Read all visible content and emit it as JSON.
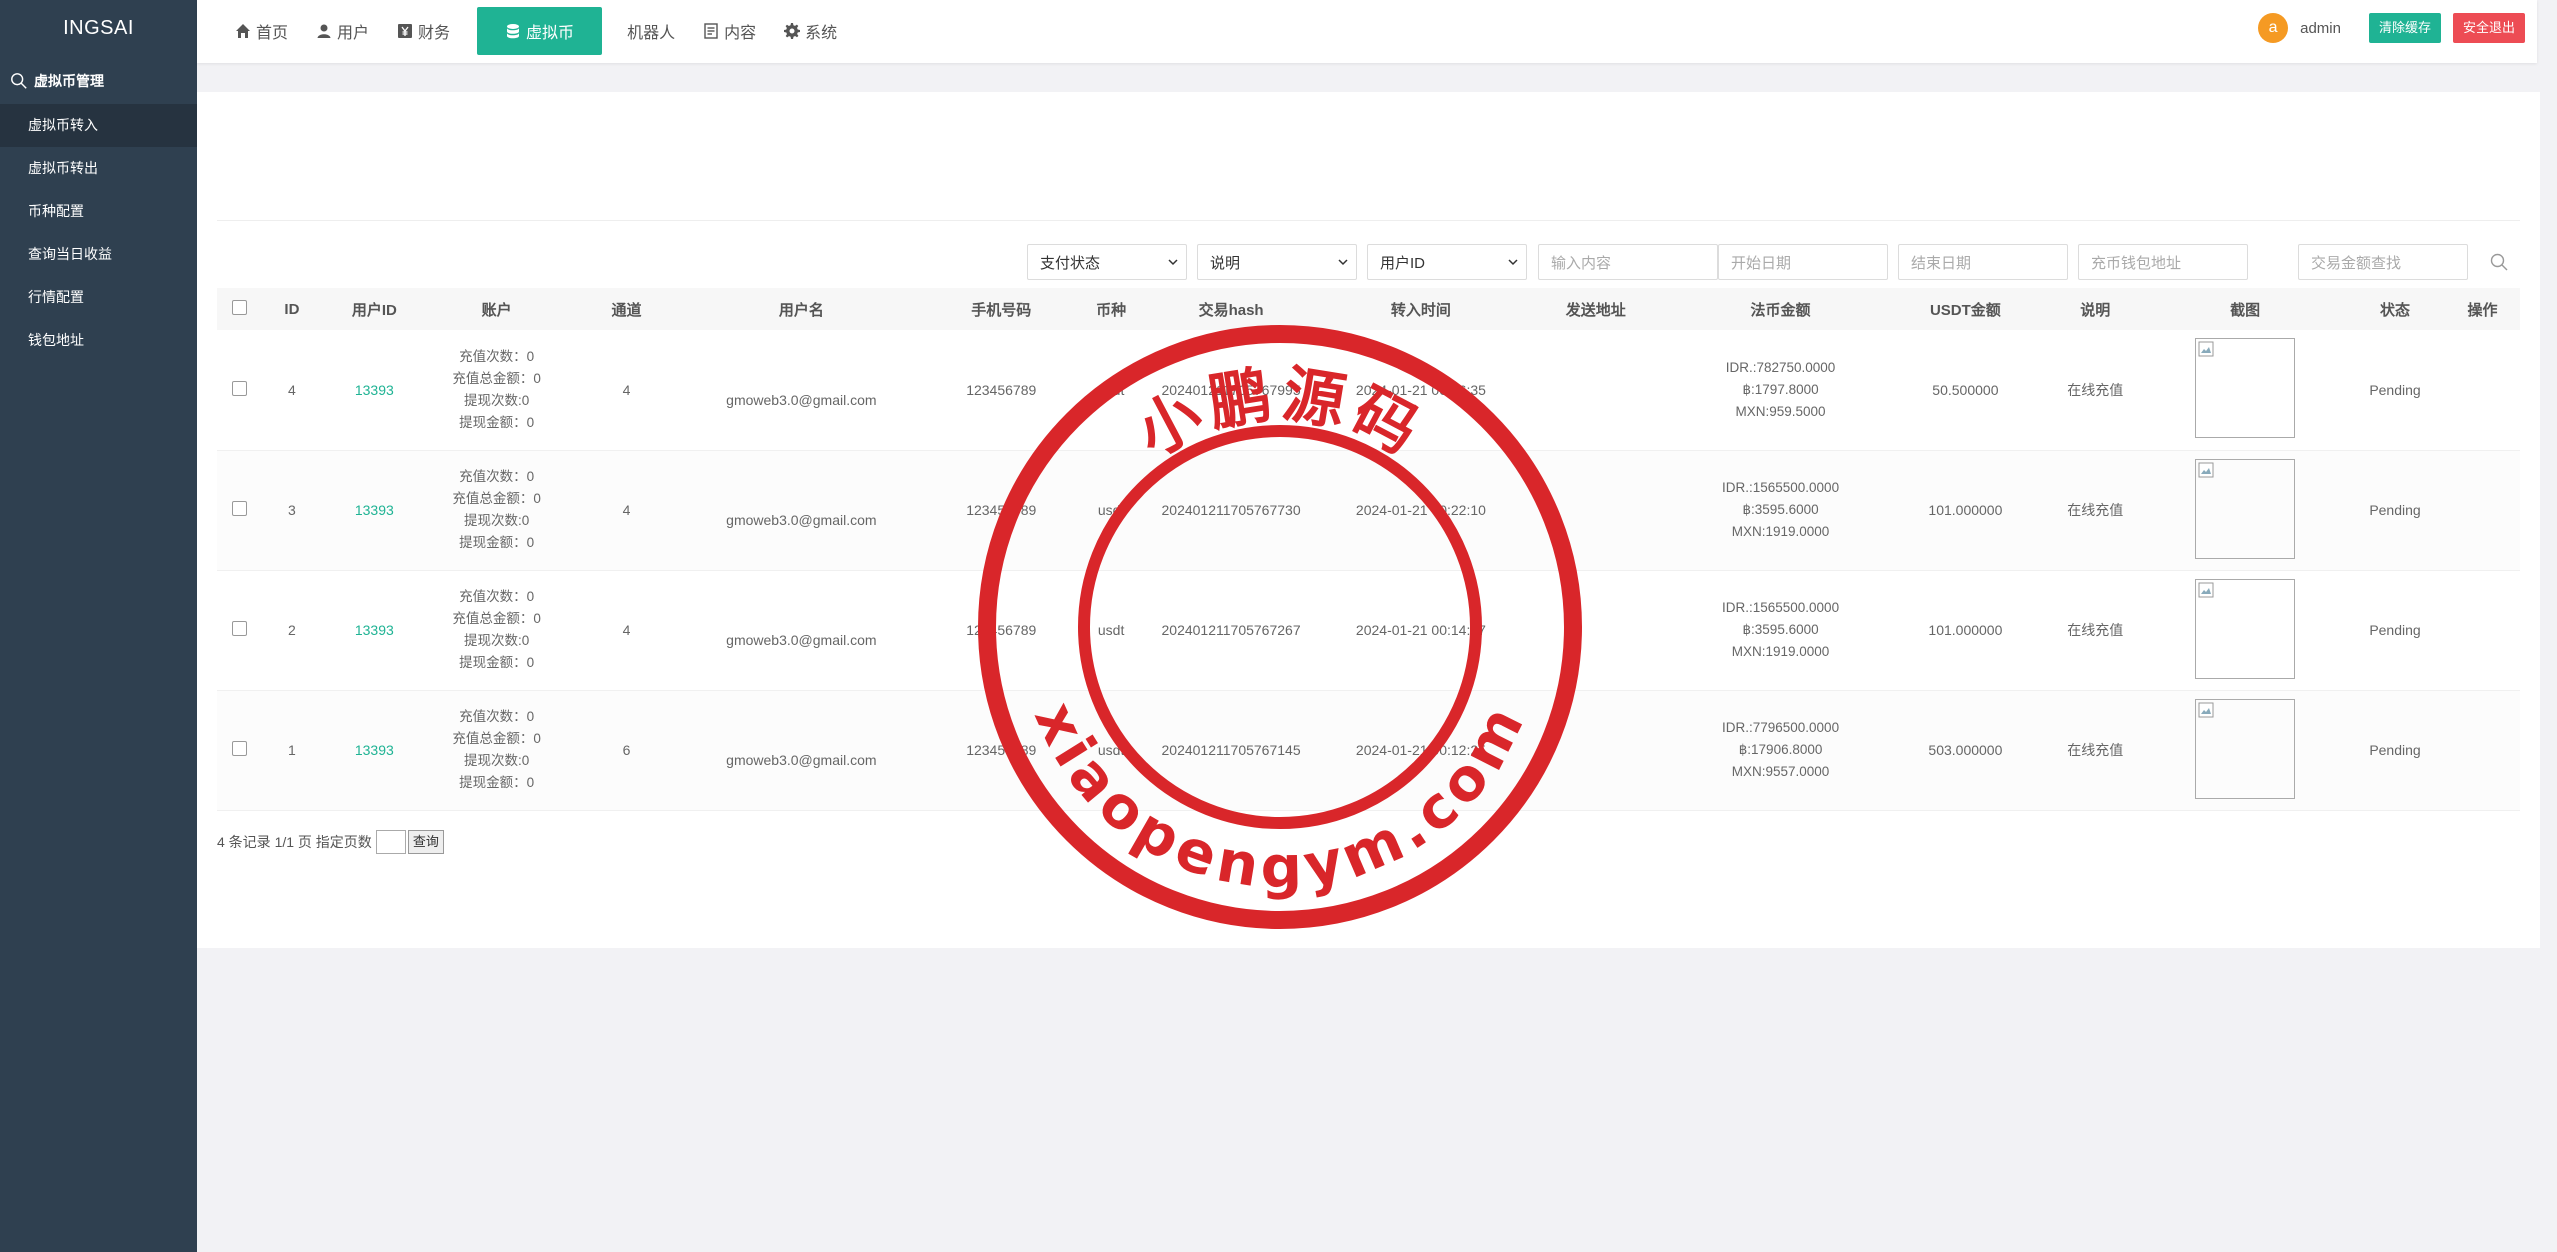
{
  "app": {
    "logo": "INGSAI"
  },
  "sidebar": {
    "section_title": "虚拟币管理",
    "items": [
      {
        "label": "虚拟币转入",
        "active": true
      },
      {
        "label": "虚拟币转出"
      },
      {
        "label": "币种配置"
      },
      {
        "label": "查询当日收益"
      },
      {
        "label": "行情配置"
      },
      {
        "label": "钱包地址"
      }
    ]
  },
  "topnav": {
    "items": [
      {
        "label": "首页",
        "icon": "home-icon"
      },
      {
        "label": "用户",
        "icon": "user-icon"
      },
      {
        "label": "财务",
        "icon": "yen-icon"
      },
      {
        "label": "虚拟币",
        "icon": "database-icon",
        "active": true
      },
      {
        "label": "机器人"
      },
      {
        "label": "内容",
        "icon": "document-icon"
      },
      {
        "label": "系统",
        "icon": "gear-icon"
      }
    ],
    "avatar_letter": "a",
    "username": "admin",
    "clear_cache": "清除缓存",
    "logout": "安全退出"
  },
  "filters": {
    "pay_status": "支付状态",
    "description": "说明",
    "user_id": "用户ID",
    "input_placeholder": "输入内容",
    "start_date_placeholder": "开始日期",
    "end_date_placeholder": "结束日期",
    "wallet_placeholder": "充币钱包地址",
    "amount_placeholder": "交易金额查找"
  },
  "table": {
    "columns": [
      "ID",
      "用户ID",
      "账户",
      "通道",
      "用户名",
      "手机号码",
      "币种",
      "交易hash",
      "转入时间",
      "发送地址",
      "法币金额",
      "USDT金额",
      "说明",
      "截图",
      "状态",
      "操作"
    ],
    "rows": [
      {
        "id": "4",
        "user_id": "13393",
        "account": [
          "充值次数：0",
          "充值总金额：0",
          "提现次数:0",
          "提现金额：0"
        ],
        "channel": "4",
        "username": "gmoweb3.0@gmail.com",
        "phone": "123456789",
        "coin": "usdt",
        "hash": "202401211705767995",
        "time": "2024-01-21 00:26:35",
        "sender": "",
        "fiat": [
          "IDR.:782750.0000",
          "฿:1797.8000",
          "MXN:959.5000"
        ],
        "usdt": "50.500000",
        "note": "在线充值",
        "status": "Pending"
      },
      {
        "id": "3",
        "user_id": "13393",
        "account": [
          "充值次数：0",
          "充值总金额：0",
          "提现次数:0",
          "提现金额：0"
        ],
        "channel": "4",
        "username": "gmoweb3.0@gmail.com",
        "phone": "123456789",
        "coin": "usdt",
        "hash": "202401211705767730",
        "time": "2024-01-21 00:22:10",
        "sender": "",
        "fiat": [
          "IDR.:1565500.0000",
          "฿:3595.6000",
          "MXN:1919.0000"
        ],
        "usdt": "101.000000",
        "note": "在线充值",
        "status": "Pending"
      },
      {
        "id": "2",
        "user_id": "13393",
        "account": [
          "充值次数：0",
          "充值总金额：0",
          "提现次数:0",
          "提现金额：0"
        ],
        "channel": "4",
        "username": "gmoweb3.0@gmail.com",
        "phone": "123456789",
        "coin": "usdt",
        "hash": "202401211705767267",
        "time": "2024-01-21 00:14:27",
        "sender": "",
        "fiat": [
          "IDR.:1565500.0000",
          "฿:3595.6000",
          "MXN:1919.0000"
        ],
        "usdt": "101.000000",
        "note": "在线充值",
        "status": "Pending"
      },
      {
        "id": "1",
        "user_id": "13393",
        "account": [
          "充值次数：0",
          "充值总金额：0",
          "提现次数:0",
          "提现金额：0"
        ],
        "channel": "6",
        "username": "gmoweb3.0@gmail.com",
        "phone": "123456789",
        "coin": "usdt",
        "hash": "202401211705767145",
        "time": "2024-01-21 00:12:25",
        "sender": "",
        "fiat": [
          "IDR.:7796500.0000",
          "฿:17906.8000",
          "MXN:9557.0000"
        ],
        "usdt": "503.000000",
        "note": "在线充值",
        "status": "Pending"
      }
    ]
  },
  "pager": {
    "summary": "4 条记录 1/1 页 指定页数",
    "go": "查询"
  },
  "watermark": {
    "top_text": "小鹏源码",
    "bottom_text": "xiaopengym.com",
    "color": "#d9262a"
  },
  "colors": {
    "accent": "#1fb394",
    "danger": "#ed4c54",
    "sidebar": "#2f4050",
    "avatar": "#f59a23"
  }
}
